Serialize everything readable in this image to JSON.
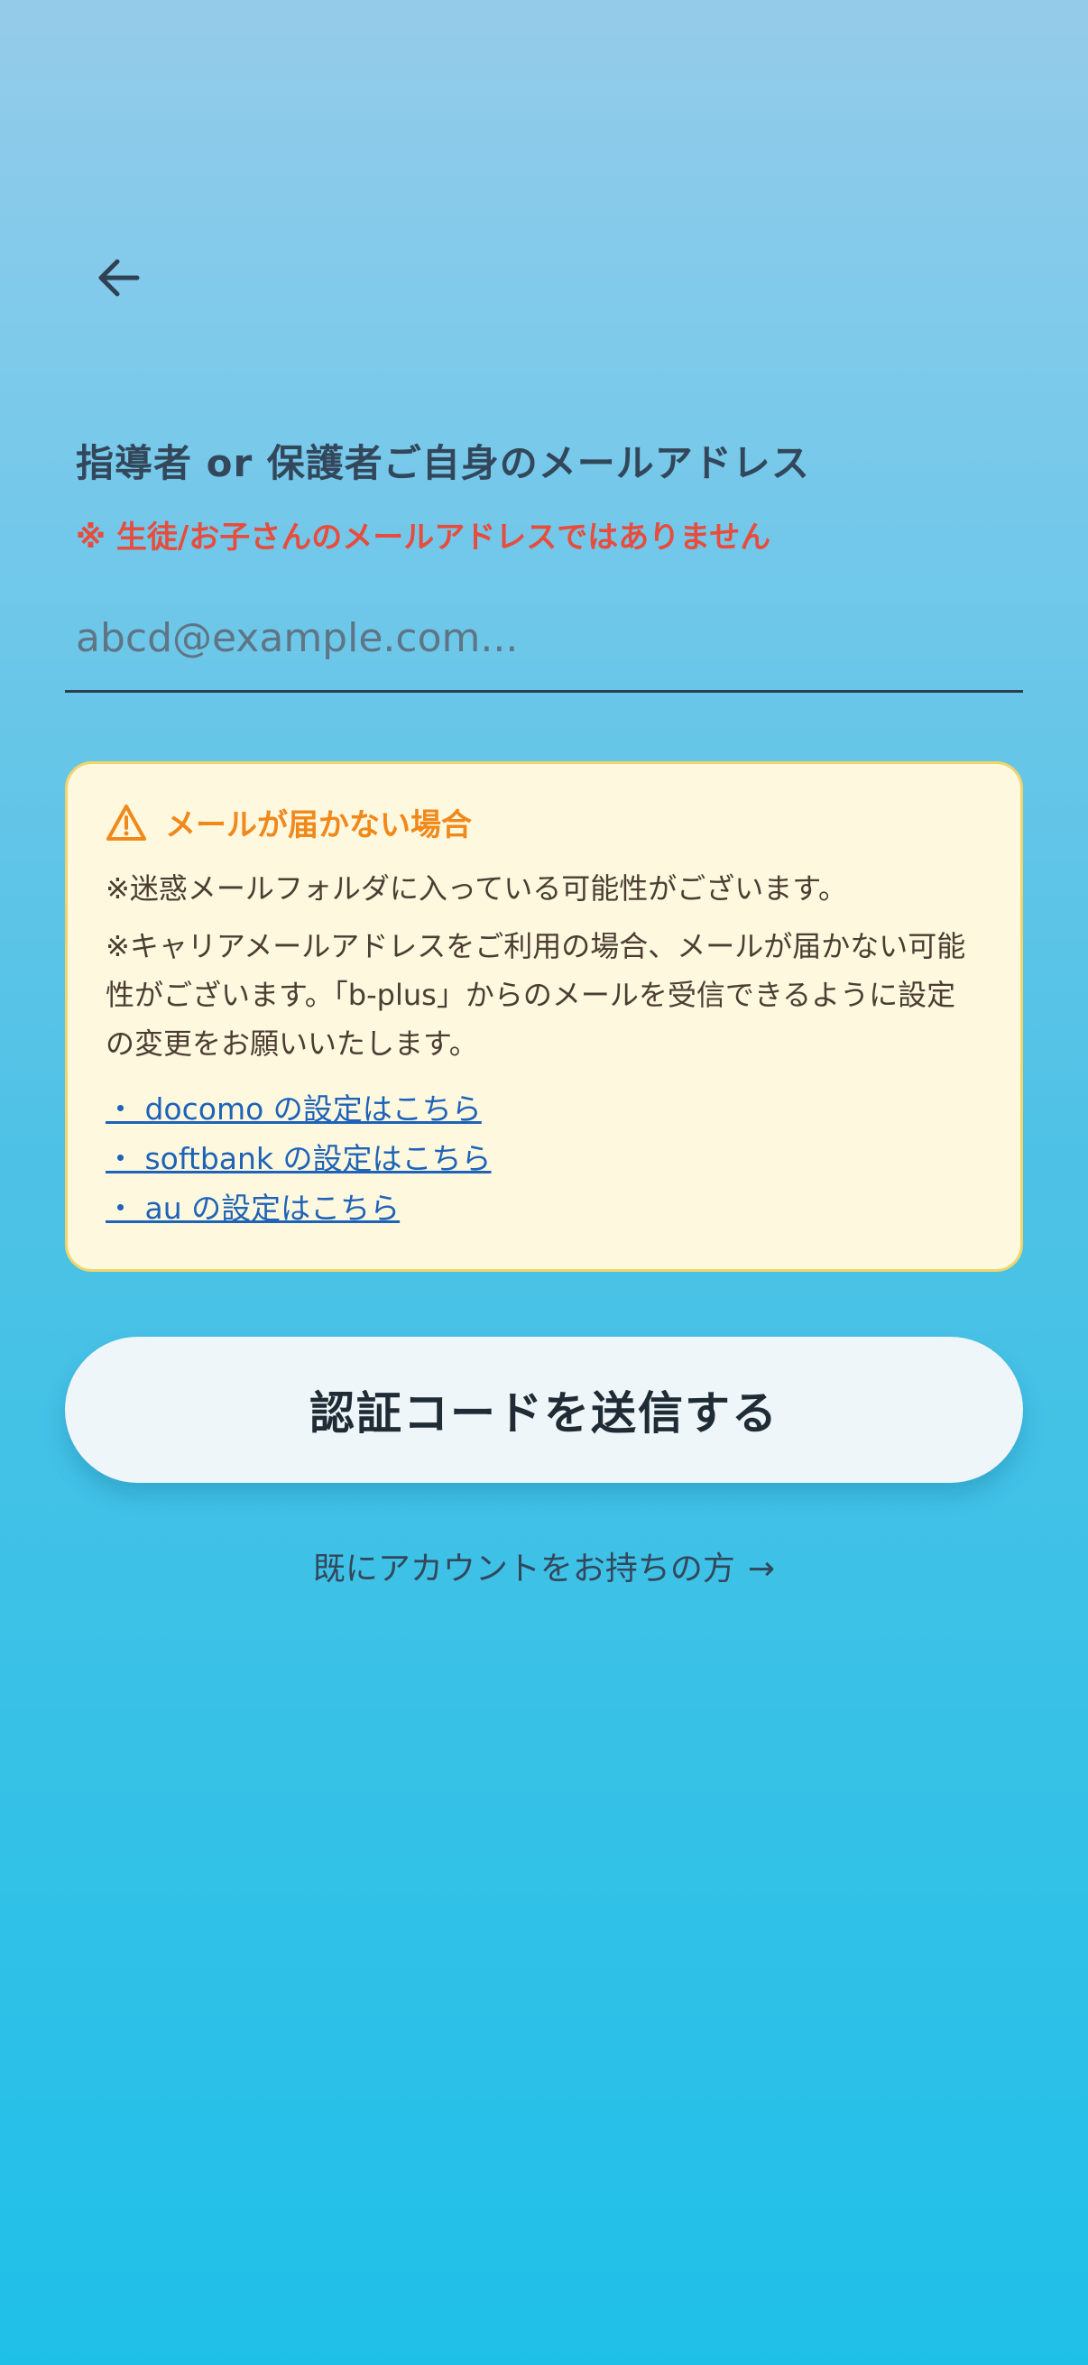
{
  "header": {
    "back_icon": "arrow-left-icon"
  },
  "form": {
    "label": "指導者 or 保護者ご自身のメールアドレス",
    "warning": "※ 生徒/お子さんのメールアドレスではありません",
    "email_value": "",
    "email_placeholder": "abcd@example.com..."
  },
  "notice": {
    "icon": "warning-triangle-icon",
    "title": "メールが届かない場合",
    "line1": "※迷惑メールフォルダに入っている可能性がございます。",
    "line2": "※キャリアメールアドレスをご利用の場合、メールが届かない可能性がございます。「b-plus」からのメールを受信できるように設定の変更をお願いいたします。",
    "links": [
      "・ docomo の設定はこちら",
      "・ softbank の設定はこちら",
      "・ au の設定はこちら"
    ]
  },
  "actions": {
    "submit_label": "認証コードを送信する",
    "login_label": "既にアカウントをお持ちの方",
    "login_arrow": "→"
  },
  "colors": {
    "warning_red": "#e74c3c",
    "notice_orange": "#f0881a",
    "link_blue": "#1e63b8",
    "notice_bg": "#fef8df",
    "notice_border": "#f1d46a"
  }
}
